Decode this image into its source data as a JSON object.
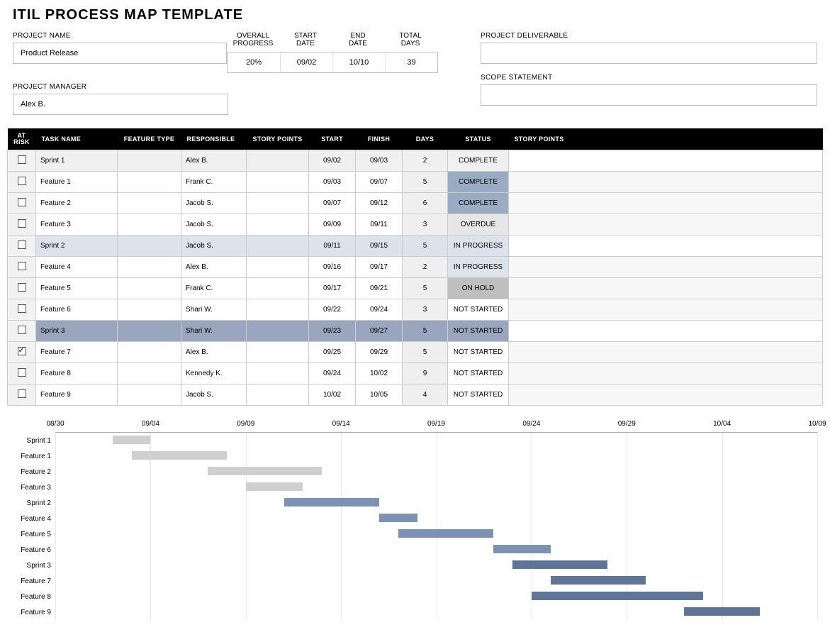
{
  "title": "ITIL PROCESS MAP TEMPLATE",
  "labels": {
    "projectName": "PROJECT NAME",
    "projectManager": "PROJECT MANAGER",
    "projectDeliverable": "PROJECT DELIVERABLE",
    "scopeStatement": "SCOPE STATEMENT",
    "overallProgress": "OVERALL\nPROGRESS",
    "startDate": "START\nDATE",
    "endDate": "END\nDATE",
    "totalDays": "TOTAL\nDAYS"
  },
  "project": {
    "name": "Product Release",
    "manager": "Alex B.",
    "progress": "20%",
    "start": "09/02",
    "end": "10/10",
    "days": "39",
    "deliverable": "",
    "scope": ""
  },
  "columns": [
    "AT RISK",
    "TASK NAME",
    "FEATURE TYPE",
    "RESPONSIBLE",
    "STORY POINTS",
    "START",
    "FINISH",
    "DAYS",
    "STATUS",
    "STORY POINTS"
  ],
  "rows": [
    {
      "sprint": "s1",
      "risk": false,
      "task": "Sprint 1",
      "type": "",
      "resp": "Alex B.",
      "sp": "",
      "start": "09/02",
      "finish": "09/03",
      "days": "2",
      "status": "COMPLETE"
    },
    {
      "risk": false,
      "task": "Feature 1",
      "type": "",
      "resp": "Frank C.",
      "sp": "",
      "start": "09/03",
      "finish": "09/07",
      "days": "5",
      "status": "COMPLETE"
    },
    {
      "risk": false,
      "task": "Feature 2",
      "type": "",
      "resp": "Jacob S.",
      "sp": "",
      "start": "09/07",
      "finish": "09/12",
      "days": "6",
      "status": "COMPLETE"
    },
    {
      "risk": false,
      "task": "Feature 3",
      "type": "",
      "resp": "Jacob S.",
      "sp": "",
      "start": "09/09",
      "finish": "09/11",
      "days": "3",
      "status": "OVERDUE"
    },
    {
      "sprint": "s2",
      "risk": false,
      "task": "Sprint 2",
      "type": "",
      "resp": "Jacob S.",
      "sp": "",
      "start": "09/11",
      "finish": "09/15",
      "days": "5",
      "status": "IN PROGRESS"
    },
    {
      "risk": false,
      "task": "Feature 4",
      "type": "",
      "resp": "Alex B.",
      "sp": "",
      "start": "09/16",
      "finish": "09/17",
      "days": "2",
      "status": "IN PROGRESS"
    },
    {
      "risk": false,
      "task": "Feature 5",
      "type": "",
      "resp": "Frank C.",
      "sp": "",
      "start": "09/17",
      "finish": "09/21",
      "days": "5",
      "status": "ON HOLD"
    },
    {
      "risk": false,
      "task": "Feature 6",
      "type": "",
      "resp": "Shari W.",
      "sp": "",
      "start": "09/22",
      "finish": "09/24",
      "days": "3",
      "status": "NOT STARTED"
    },
    {
      "sprint": "s3",
      "risk": false,
      "task": "Sprint 3",
      "type": "",
      "resp": "Shari W.",
      "sp": "",
      "start": "09/23",
      "finish": "09/27",
      "days": "5",
      "status": "NOT STARTED"
    },
    {
      "risk": true,
      "task": "Feature 7",
      "type": "",
      "resp": "Alex B.",
      "sp": "",
      "start": "09/25",
      "finish": "09/29",
      "days": "5",
      "status": "NOT STARTED"
    },
    {
      "risk": false,
      "task": "Feature 8",
      "type": "",
      "resp": "Kennedy K.",
      "sp": "",
      "start": "09/24",
      "finish": "10/02",
      "days": "9",
      "status": "NOT STARTED"
    },
    {
      "risk": false,
      "task": "Feature 9",
      "type": "",
      "resp": "Jacob S.",
      "sp": "",
      "start": "10/02",
      "finish": "10/05",
      "days": "4",
      "status": "NOT STARTED"
    }
  ],
  "chart_data": {
    "type": "gantt",
    "x_ticks": [
      "08/30",
      "09/04",
      "09/09",
      "09/14",
      "09/19",
      "09/24",
      "09/29",
      "10/04",
      "10/09"
    ],
    "x_range": [
      "08/30",
      "10/09"
    ],
    "tasks": [
      {
        "name": "Sprint 1",
        "start": "09/02",
        "end": "09/03",
        "color": "grey"
      },
      {
        "name": "Feature 1",
        "start": "09/03",
        "end": "09/07",
        "color": "grey"
      },
      {
        "name": "Feature 2",
        "start": "09/07",
        "end": "09/12",
        "color": "grey"
      },
      {
        "name": "Feature 3",
        "start": "09/09",
        "end": "09/11",
        "color": "grey"
      },
      {
        "name": "Sprint 2",
        "start": "09/11",
        "end": "09/15",
        "color": "blue"
      },
      {
        "name": "Feature 4",
        "start": "09/16",
        "end": "09/17",
        "color": "blue"
      },
      {
        "name": "Feature 5",
        "start": "09/17",
        "end": "09/21",
        "color": "blue"
      },
      {
        "name": "Feature 6",
        "start": "09/22",
        "end": "09/24",
        "color": "blue"
      },
      {
        "name": "Sprint 3",
        "start": "09/23",
        "end": "09/27",
        "color": "dblue"
      },
      {
        "name": "Feature 7",
        "start": "09/25",
        "end": "09/29",
        "color": "dblue"
      },
      {
        "name": "Feature 8",
        "start": "09/24",
        "end": "10/02",
        "color": "dblue"
      },
      {
        "name": "Feature 9",
        "start": "10/02",
        "end": "10/05",
        "color": "dblue"
      }
    ]
  }
}
